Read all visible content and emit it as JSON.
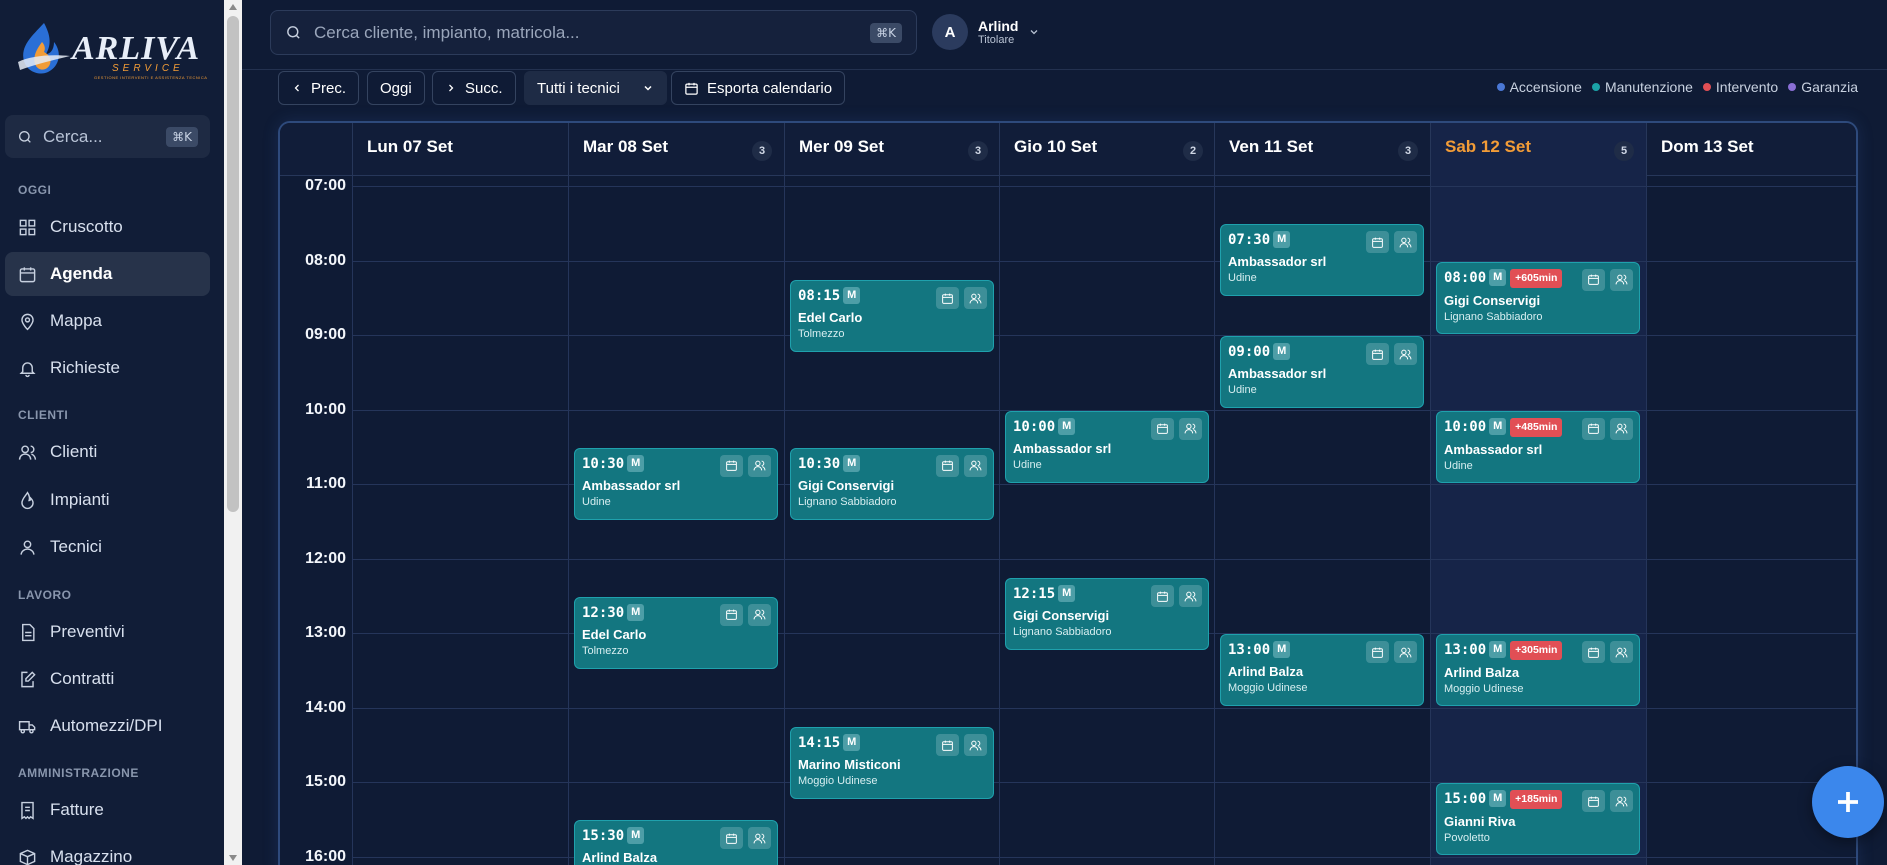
{
  "brand": {
    "name": "ARLIVA",
    "sub": "SERVICE",
    "tagline": "GESTIONE INTERVENTI E ASSISTENZA TECNICA"
  },
  "sidebar": {
    "search_placeholder": "Cerca...",
    "shortcut": "⌘K",
    "sections": [
      {
        "title": "OGGI",
        "items": [
          {
            "label": "Cruscotto",
            "icon": "grid-icon"
          },
          {
            "label": "Agenda",
            "icon": "calendar-icon",
            "active": true
          },
          {
            "label": "Mappa",
            "icon": "map-pin-icon"
          },
          {
            "label": "Richieste",
            "icon": "bell-icon"
          }
        ]
      },
      {
        "title": "CLIENTI",
        "items": [
          {
            "label": "Clienti",
            "icon": "users-icon"
          },
          {
            "label": "Impianti",
            "icon": "flame-icon"
          },
          {
            "label": "Tecnici",
            "icon": "user-icon"
          }
        ]
      },
      {
        "title": "LAVORO",
        "items": [
          {
            "label": "Preventivi",
            "icon": "file-icon"
          },
          {
            "label": "Contratti",
            "icon": "edit-file-icon"
          },
          {
            "label": "Automezzi/DPI",
            "icon": "truck-icon"
          }
        ]
      },
      {
        "title": "AMMINISTRAZIONE",
        "items": [
          {
            "label": "Fatture",
            "icon": "receipt-icon"
          },
          {
            "label": "Magazzino",
            "icon": "box-icon"
          }
        ]
      }
    ]
  },
  "topbar": {
    "search_placeholder": "Cerca cliente, impianto, matricola...",
    "shortcut": "⌘K",
    "user": {
      "initial": "A",
      "name": "Arlind",
      "role": "Titolare"
    }
  },
  "toolbar": {
    "prev": "Prec.",
    "today": "Oggi",
    "next": "Succ.",
    "filter": "Tutti i tecnici",
    "export": "Esporta calendario",
    "legend": [
      {
        "label": "Accensione",
        "color": "#4a78d6"
      },
      {
        "label": "Manutenzione",
        "color": "#1ba3a8"
      },
      {
        "label": "Intervento",
        "color": "#e14f55"
      },
      {
        "label": "Garanzia",
        "color": "#8a6fd6"
      }
    ]
  },
  "calendar": {
    "days": [
      {
        "label": "Lun 07 Set",
        "count": ""
      },
      {
        "label": "Mar 08 Set",
        "count": "3"
      },
      {
        "label": "Mer 09 Set",
        "count": "3"
      },
      {
        "label": "Gio 10 Set",
        "count": "2"
      },
      {
        "label": "Ven 11 Set",
        "count": "3"
      },
      {
        "label": "Sab 12 Set",
        "count": "5",
        "today": true
      },
      {
        "label": "Dom 13 Set",
        "count": ""
      }
    ],
    "hours": [
      "07:00",
      "08:00",
      "09:00",
      "10:00",
      "11:00",
      "12:00",
      "13:00",
      "14:00",
      "15:00",
      "16:00"
    ],
    "events": [
      {
        "day": 1,
        "time": "10:30",
        "type": "M",
        "late": "",
        "client": "Ambassador srl",
        "city": "Udine"
      },
      {
        "day": 1,
        "time": "12:30",
        "type": "M",
        "late": "",
        "client": "Edel Carlo",
        "city": "Tolmezzo"
      },
      {
        "day": 1,
        "time": "15:30",
        "type": "M",
        "late": "",
        "client": "Arlind Balza",
        "city": ""
      },
      {
        "day": 2,
        "time": "08:15",
        "type": "M",
        "late": "",
        "client": "Edel Carlo",
        "city": "Tolmezzo"
      },
      {
        "day": 2,
        "time": "10:30",
        "type": "M",
        "late": "",
        "client": "Gigi Conservigi",
        "city": "Lignano Sabbiadoro"
      },
      {
        "day": 2,
        "time": "14:15",
        "type": "M",
        "late": "",
        "client": "Marino Misticoni",
        "city": "Moggio Udinese"
      },
      {
        "day": 3,
        "time": "10:00",
        "type": "M",
        "late": "",
        "client": "Ambassador srl",
        "city": "Udine"
      },
      {
        "day": 3,
        "time": "12:15",
        "type": "M",
        "late": "",
        "client": "Gigi Conservigi",
        "city": "Lignano Sabbiadoro"
      },
      {
        "day": 4,
        "time": "07:30",
        "type": "M",
        "late": "",
        "client": "Ambassador srl",
        "city": "Udine"
      },
      {
        "day": 4,
        "time": "09:00",
        "type": "M",
        "late": "",
        "client": "Ambassador srl",
        "city": "Udine"
      },
      {
        "day": 4,
        "time": "13:00",
        "type": "M",
        "late": "",
        "client": "Arlind Balza",
        "city": "Moggio Udinese"
      },
      {
        "day": 5,
        "time": "08:00",
        "type": "M",
        "late": "+605min",
        "client": "Gigi Conservigi",
        "city": "Lignano Sabbiadoro"
      },
      {
        "day": 5,
        "time": "10:00",
        "type": "M",
        "late": "+485min",
        "client": "Ambassador srl",
        "city": "Udine"
      },
      {
        "day": 5,
        "time": "13:00",
        "type": "M",
        "late": "+305min",
        "client": "Arlind Balza",
        "city": "Moggio Udinese"
      },
      {
        "day": 5,
        "time": "15:00",
        "type": "M",
        "late": "+185min",
        "client": "Gianni Riva",
        "city": "Povoletto"
      }
    ]
  }
}
